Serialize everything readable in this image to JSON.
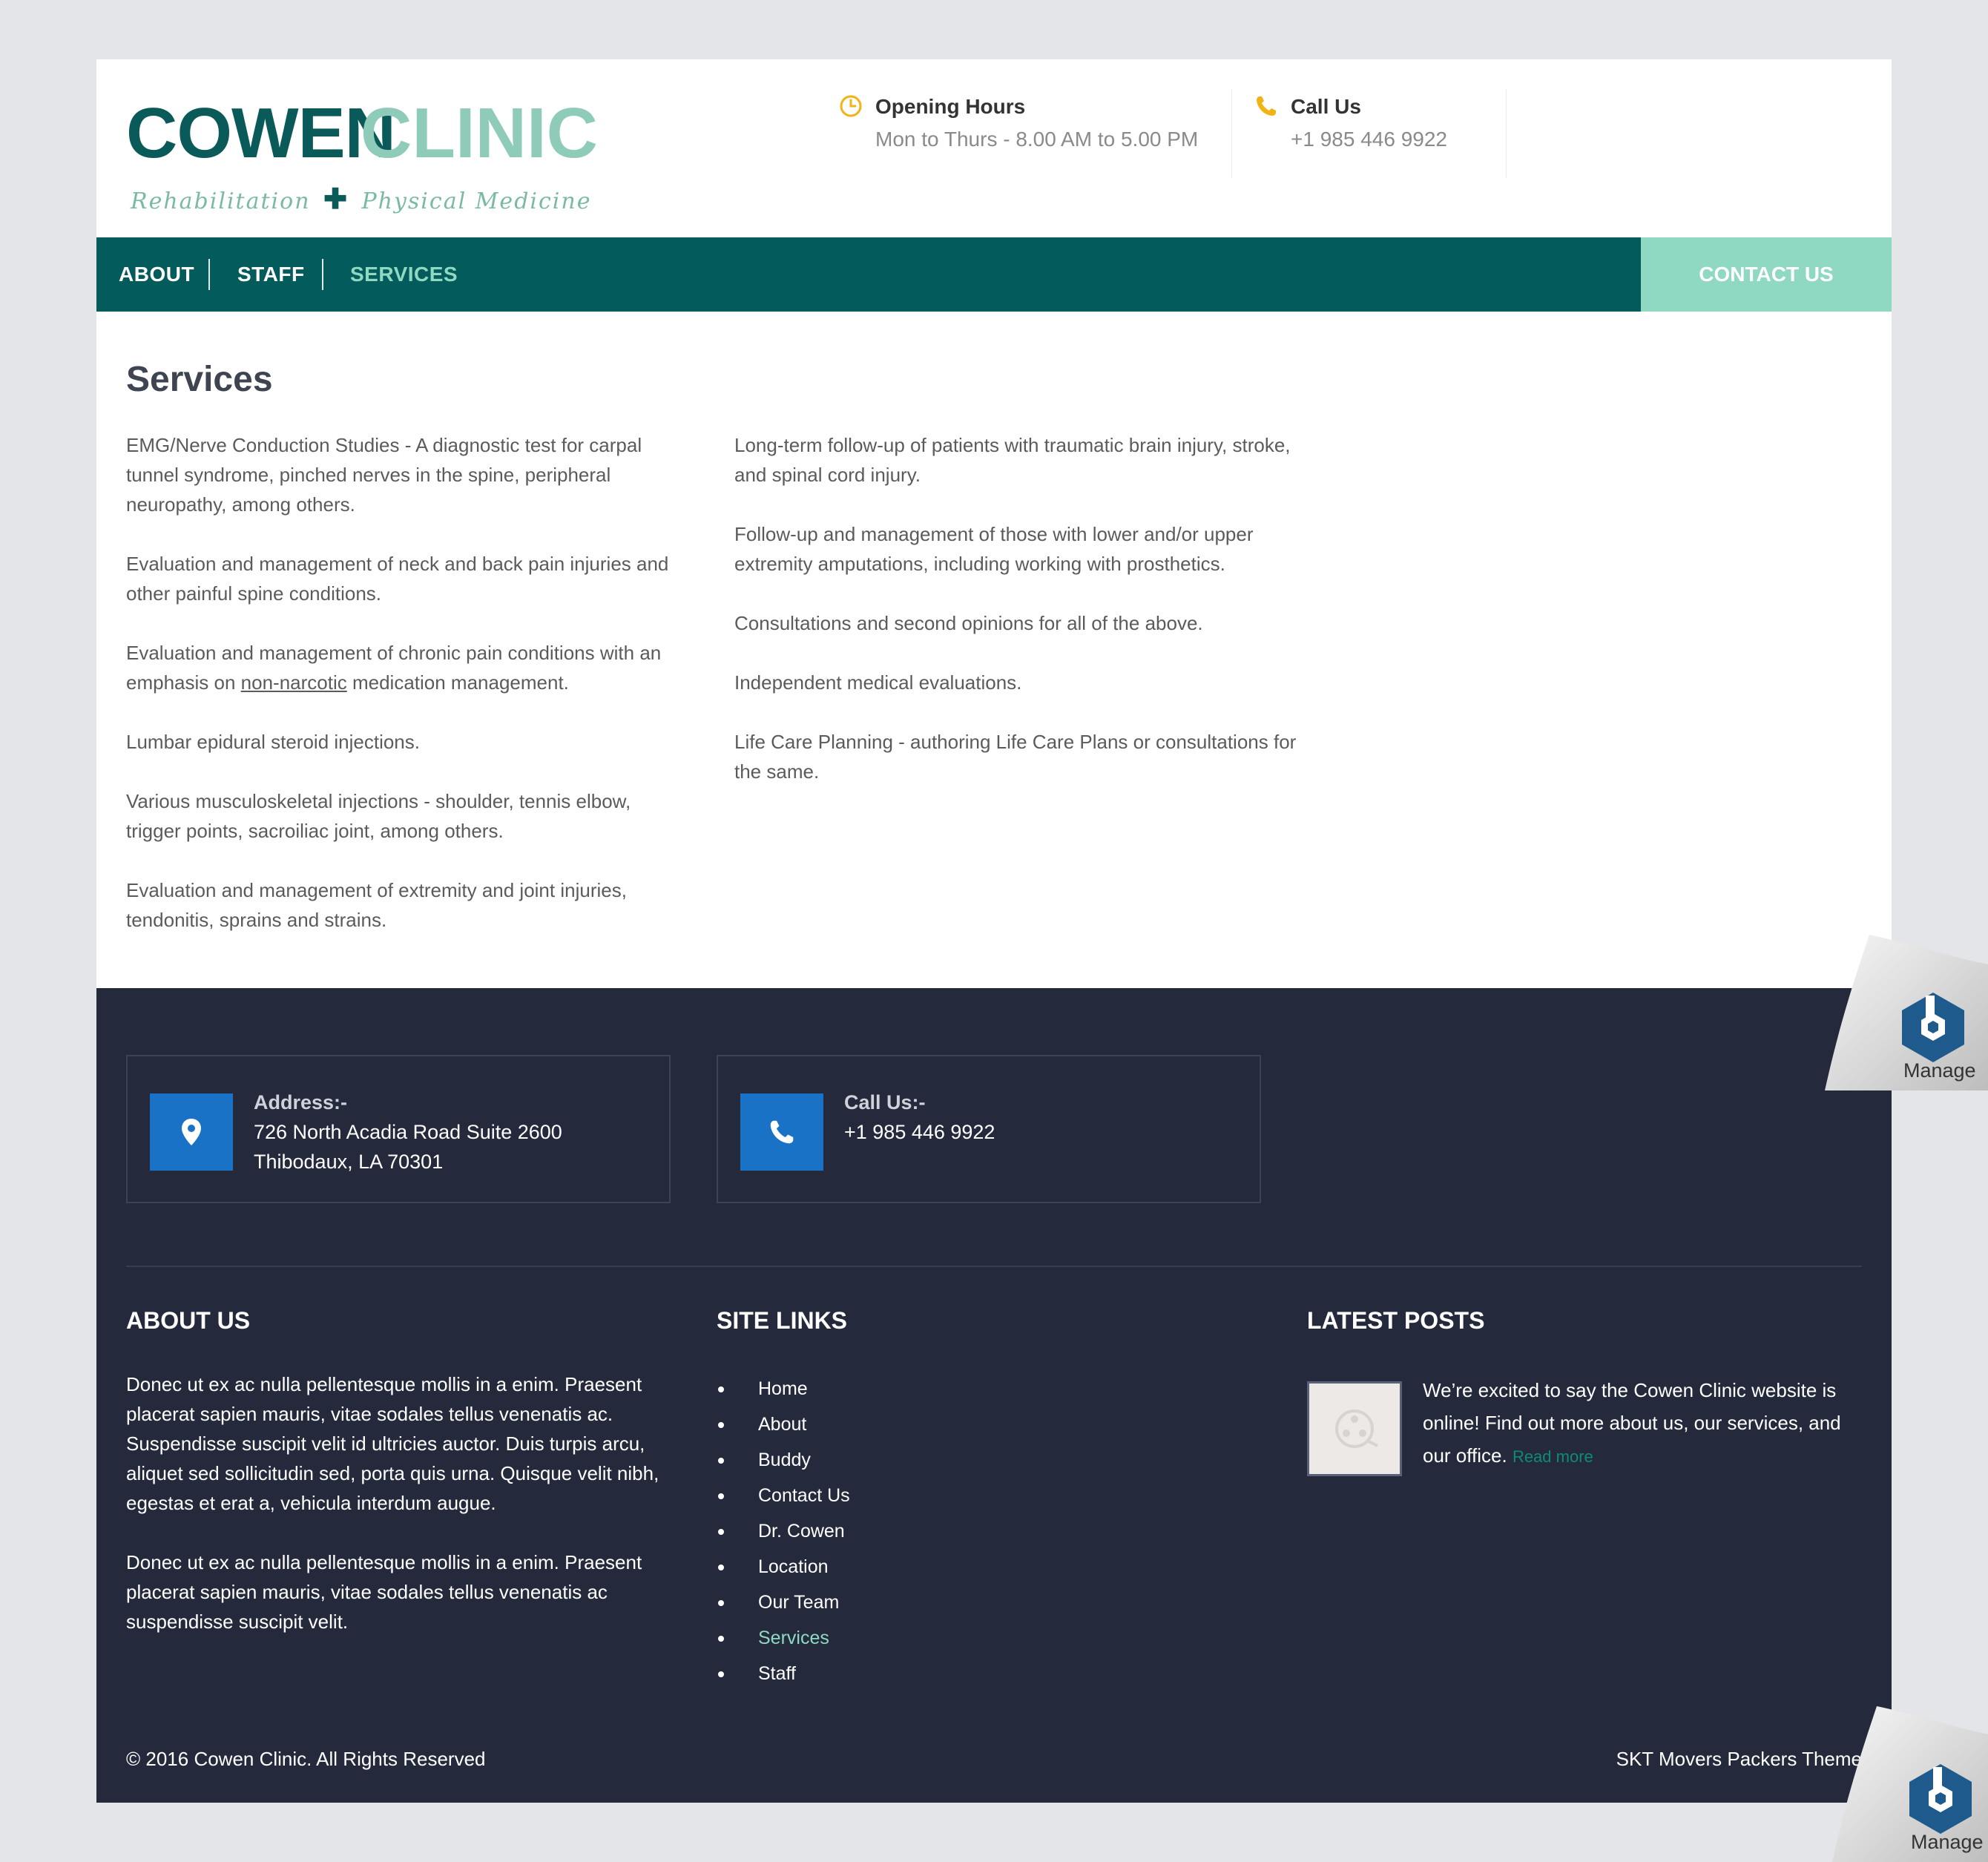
{
  "header": {
    "logo": {
      "word1": "COWEN",
      "word2": "CLINIC",
      "tagline_left": "Rehabilitation",
      "tagline_right": "Physical Medicine"
    },
    "hours": {
      "title": "Opening Hours",
      "text": "Mon to Thurs - 8.00 AM to 5.00 PM"
    },
    "call": {
      "title": "Call Us",
      "text": "+1 985 446 9922"
    }
  },
  "nav": {
    "items": [
      {
        "label": "ABOUT"
      },
      {
        "label": "STAFF"
      },
      {
        "label": "SERVICES"
      }
    ],
    "contact_button": "CONTACT US"
  },
  "content": {
    "title": "Services",
    "left": [
      "EMG/Nerve Conduction Studies - A diagnostic test for carpal tunnel syndrome, pinched nerves in the spine, peripheral neuropathy, among others.",
      "Evaluation and management of neck and back pain injuries and other painful spine conditions.",
      {
        "before": "Evaluation and management of chronic pain conditions with an emphasis on ",
        "link": "non-narcotic",
        "after": " medication management."
      },
      "Lumbar epidural steroid injections.",
      "Various musculoskeletal injections - shoulder, tennis elbow, trigger points, sacroiliac joint, among others.",
      "Evaluation and management of extremity and joint injuries, tendonitis, sprains and strains."
    ],
    "right": [
      "Long-term follow-up of patients with traumatic brain injury, stroke, and spinal cord injury.",
      "Follow-up and management of those with lower and/or upper extremity amputations, including working with prosthetics.",
      "Consultations and second opinions for all of the above.",
      "Independent medical evaluations.",
      "Life Care Planning - authoring Life Care Plans or consultations for the same."
    ]
  },
  "footer": {
    "address": {
      "title": "Address:-",
      "text": "726 North Acadia Road Suite 2600 Thibodaux, LA 70301"
    },
    "call": {
      "title": "Call Us:-",
      "text": "+1 985 446 9922"
    },
    "about": {
      "heading": "ABOUT US",
      "p1": "Donec ut ex ac nulla pellentesque mollis in a enim. Praesent placerat sapien mauris, vitae sodales tellus venenatis ac. Suspendisse suscipit velit id ultricies auctor. Duis turpis arcu, aliquet sed sollicitudin sed, porta quis urna. Quisque velit nibh, egestas et erat a, vehicula interdum augue.",
      "p2": "Donec ut ex ac nulla pellentesque mollis in a enim. Praesent placerat sapien mauris, vitae sodales tellus venenatis ac suspendisse suscipit velit."
    },
    "links": {
      "heading": "SITE LINKS",
      "items": [
        "Home",
        "About",
        "Buddy",
        "Contact Us",
        "Dr. Cowen",
        "Location",
        "Our Team",
        "Services",
        "Staff"
      ]
    },
    "posts": {
      "heading": "LATEST POSTS",
      "text": "We’re excited to say the Cowen Clinic website is online! Find out more about us, our services, and our office.",
      "read_more": "Read more"
    },
    "copyright": "© 2016 Cowen Clinic. All Rights Reserved",
    "theme": "SKT Movers Packers Theme"
  },
  "manage": {
    "label": "Manage"
  },
  "colors": {
    "brand_dark": "#045b5b",
    "brand_light": "#8fd9c3",
    "footer_bg": "#242a3c",
    "icon_blue": "#1a72c6",
    "accent_yellow": "#f2b316"
  },
  "icons": {
    "hours": "clock-icon",
    "call": "phone-icon",
    "address": "map-pin-icon",
    "footer_call": "phone-icon",
    "post_thumb": "film-reel-icon",
    "manage": "hexagon-logo-icon"
  }
}
